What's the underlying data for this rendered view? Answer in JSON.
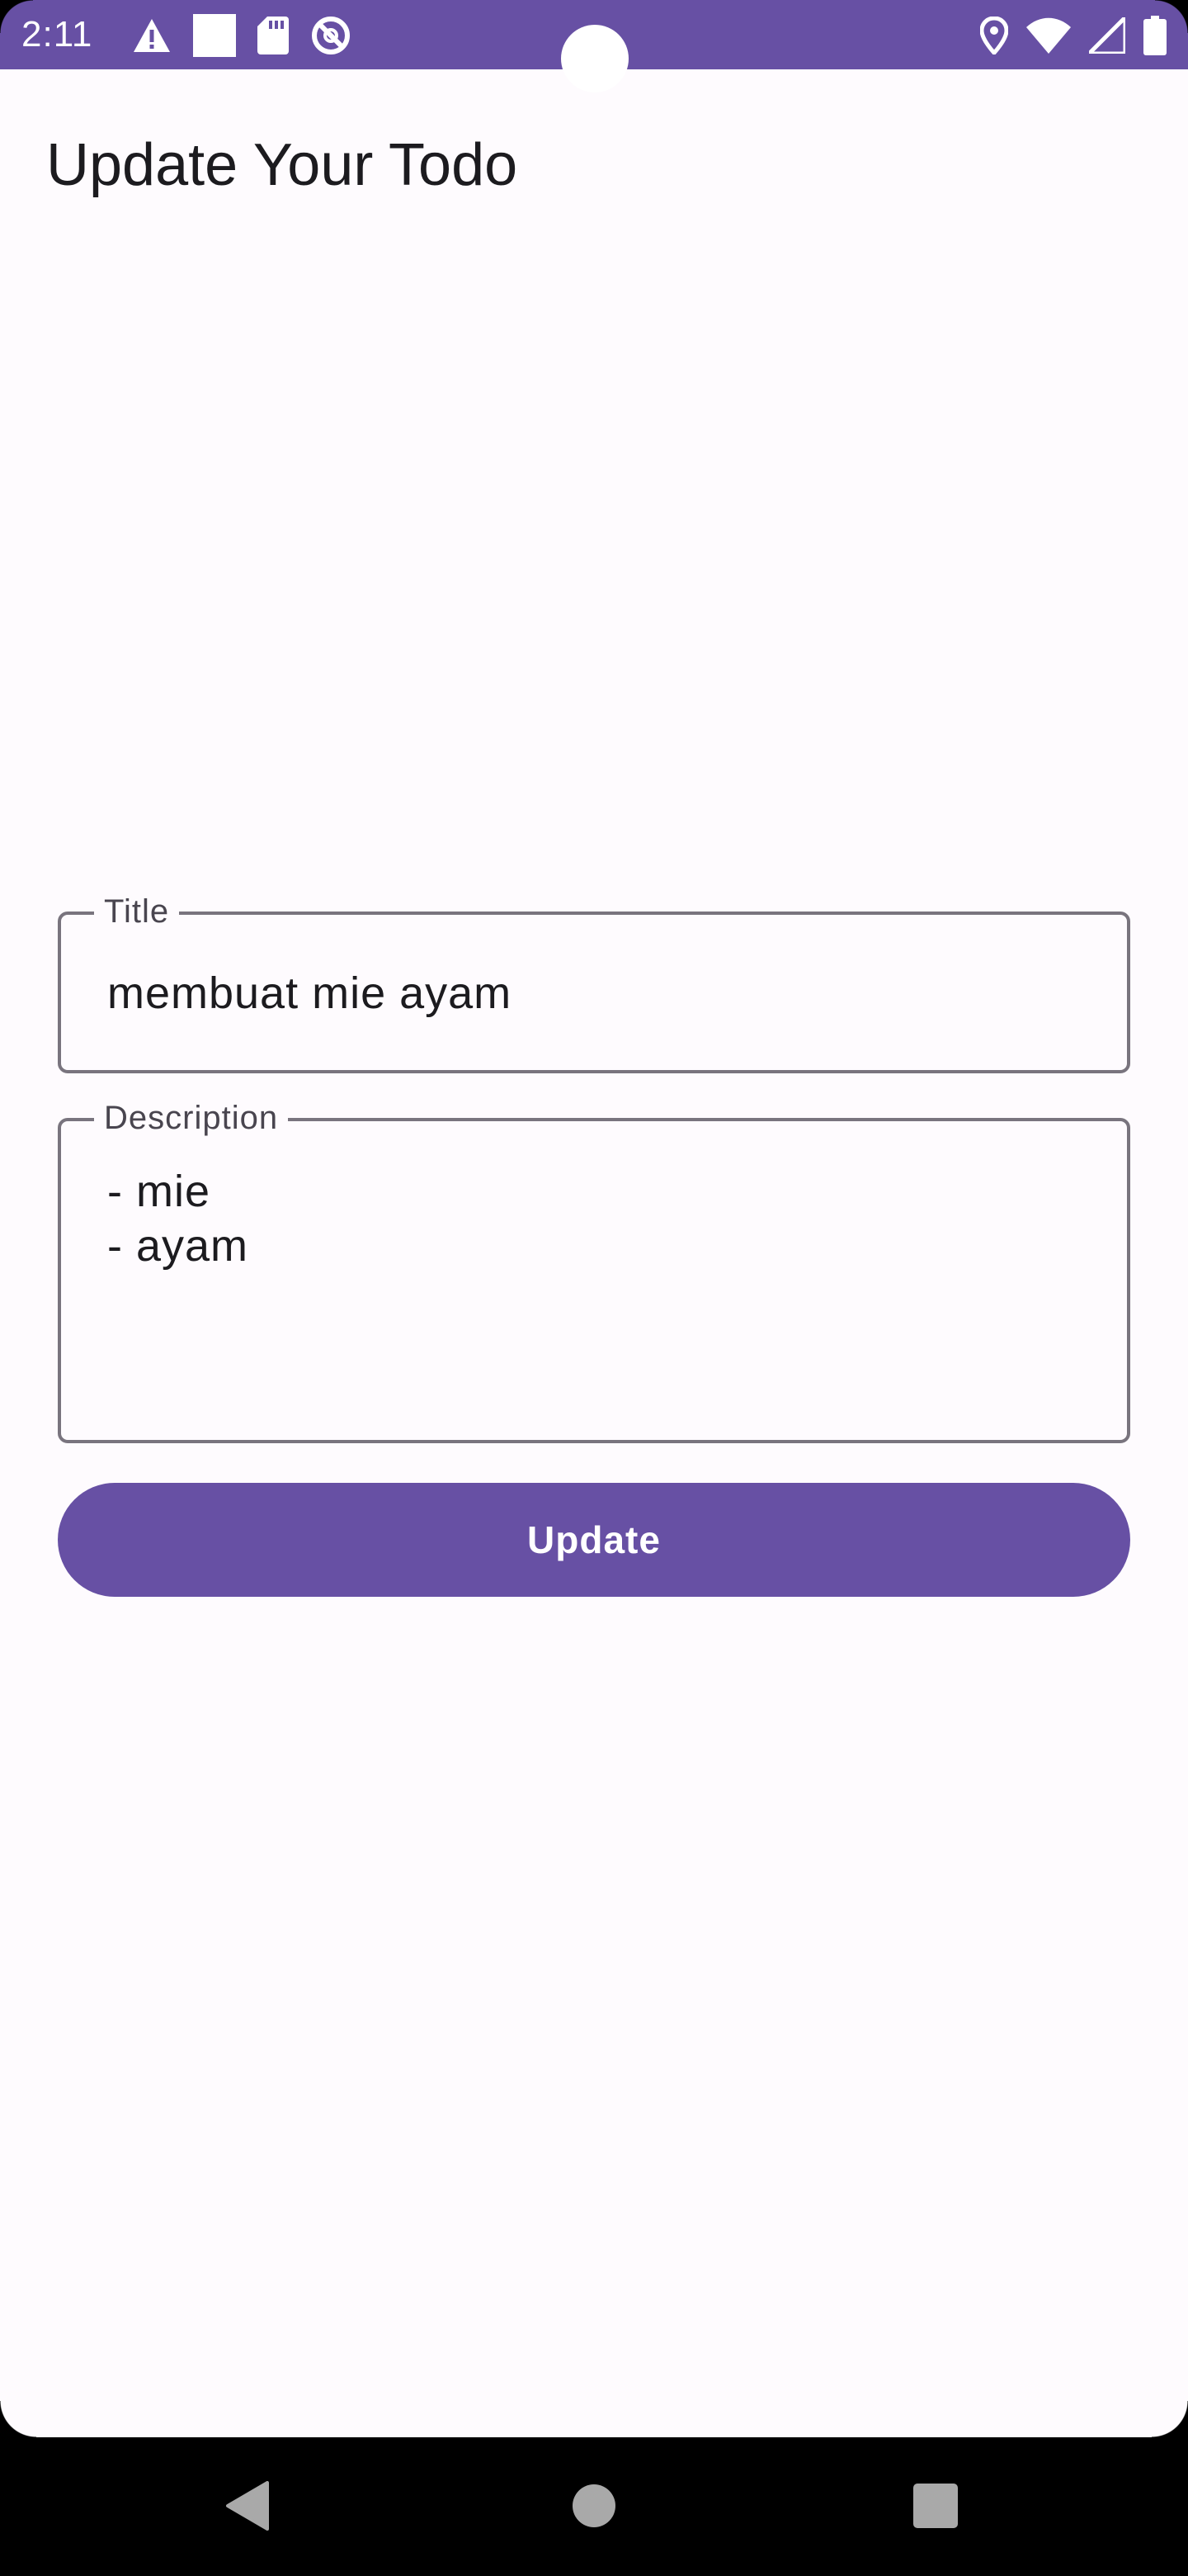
{
  "status_bar": {
    "time": "2:11",
    "background_color": "#6750a4",
    "left_icons": [
      "warning-icon",
      "square-notification-icon",
      "sd-card-icon",
      "no-sync-icon"
    ],
    "right_icons": [
      "location-icon",
      "wifi-icon",
      "signal-icon",
      "battery-icon"
    ]
  },
  "header": {
    "title": "Update Your Todo"
  },
  "form": {
    "title_field": {
      "label": "Title",
      "value": "membuat mie ayam"
    },
    "description_field": {
      "label": "Description",
      "value": "- mie\n- ayam"
    },
    "submit_label": "Update"
  },
  "colors": {
    "primary": "#6750a4",
    "background": "#fefbfe",
    "outline": "#79747e",
    "on_primary": "#ffffff"
  },
  "nav_bar": {
    "icons": [
      "back-icon",
      "home-icon",
      "recents-icon"
    ]
  }
}
